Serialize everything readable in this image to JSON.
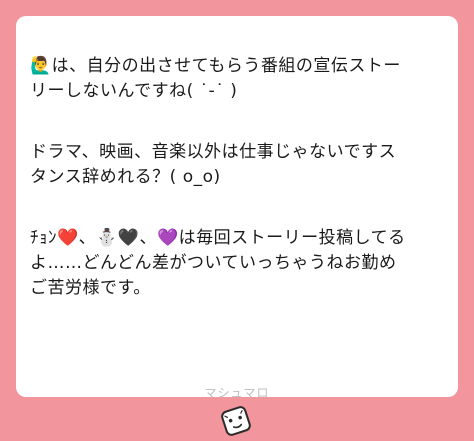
{
  "message": {
    "paragraph1": {
      "line1": "🙋‍♂️は、自分の出させてもらう番組の宣伝ストー",
      "line2": "リーしないんですね( ˙-˙ )"
    },
    "paragraph2": {
      "line1": "ドラマ、映画、音楽以外は仕事じゃないですス",
      "line2": "タンス辞めれる？( o_o)"
    },
    "paragraph3": {
      "line1": "ﾁｮﾝ❤️、⛄🖤、💜は毎回ストーリー投稿してる",
      "line2": "よ……どんどん差がついていっちゃうねお勤め",
      "line3": "ご苦労様です。"
    }
  },
  "footer": {
    "brand": "マシュマロ"
  },
  "colors": {
    "background": "#f2959c",
    "card": "#ffffff",
    "text": "#1a1a1a",
    "brand_text": "#bdbdbd"
  },
  "icons": {
    "logo": "marshmallow-mascot-icon"
  }
}
